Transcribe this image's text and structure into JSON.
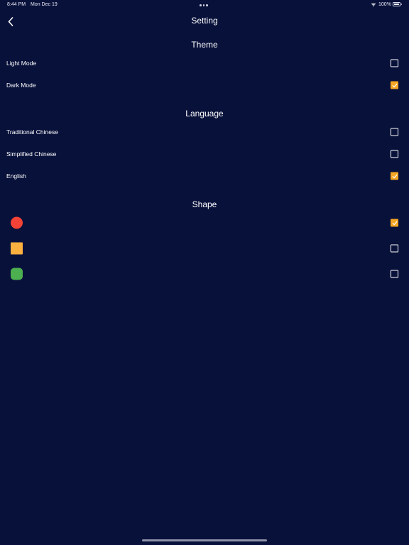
{
  "status_bar": {
    "time": "8:44 PM",
    "date": "Mon Dec 19",
    "battery": "100%"
  },
  "nav": {
    "title": "Setting"
  },
  "theme": {
    "header": "Theme",
    "options": [
      {
        "label": "Light Mode",
        "checked": false
      },
      {
        "label": "Dark Mode",
        "checked": true
      }
    ]
  },
  "language": {
    "header": "Language",
    "options": [
      {
        "label": "Traditional Chinese",
        "checked": false
      },
      {
        "label": "Simplified Chinese",
        "checked": false
      },
      {
        "label": "English",
        "checked": true
      }
    ]
  },
  "shape": {
    "header": "Shape",
    "options": [
      {
        "shape": "circle",
        "color": "#f44336",
        "checked": true
      },
      {
        "shape": "square",
        "color": "#fbb040",
        "checked": false
      },
      {
        "shape": "rounded-square",
        "color": "#4caf50",
        "checked": false
      }
    ]
  },
  "colors": {
    "background": "#08113a",
    "accent": "#f5a623"
  }
}
